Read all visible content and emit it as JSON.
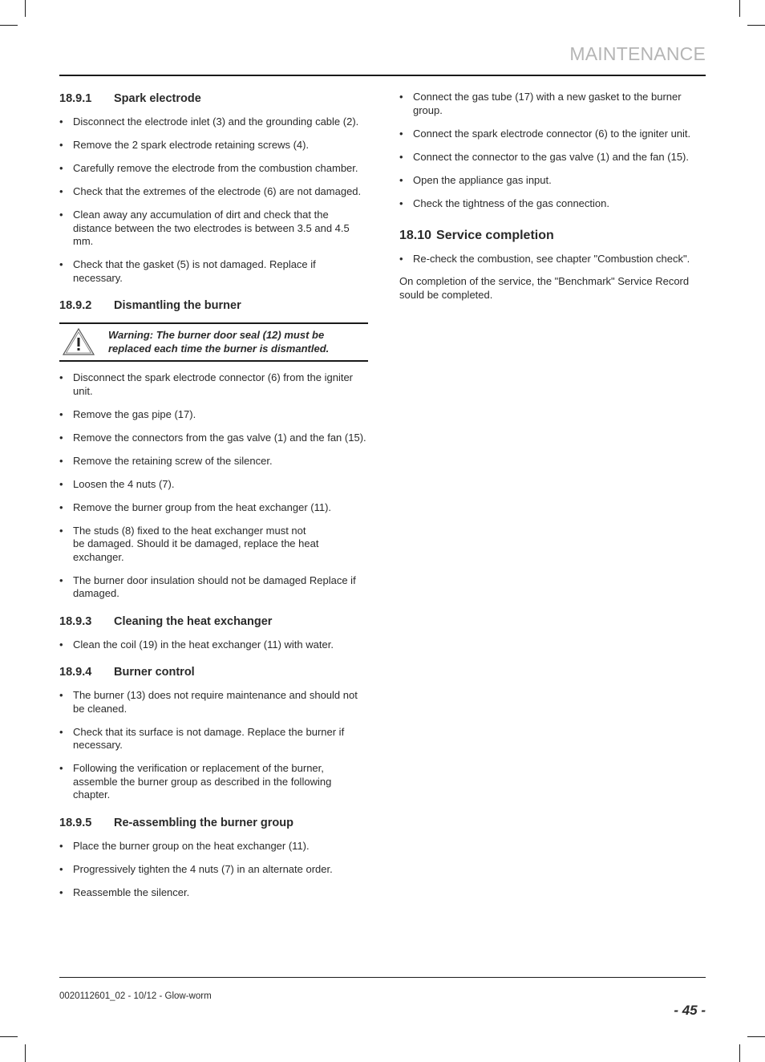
{
  "header": {
    "title": "MAINTENANCE"
  },
  "left_column": {
    "sections": [
      {
        "number": "18.9.1",
        "title": "Spark electrode",
        "items": [
          "Disconnect the electrode inlet (3) and the grounding cable (2).",
          "Remove the 2 spark electrode retaining screws (4).",
          "Carefully remove the electrode from the combustion chamber.",
          "Check that the extremes of the electrode (6) are not damaged.",
          "Clean away any accumulation of dirt and check that the distance between the two electrodes is between 3.5 and 4.5 mm.",
          "Check that the gasket (5) is not damaged. Replace if necessary."
        ]
      },
      {
        "number": "18.9.2",
        "title": "Dismantling the burner",
        "warning": "Warning: The burner door seal (12) must be replaced each time the burner is dismantled.",
        "items": [
          "Disconnect the spark electrode connector (6) from the igniter unit.",
          "Remove the gas pipe (17).",
          "Remove the connectors from the gas valve (1) and the fan (15).",
          "Remove the retaining screw of the silencer.",
          "Loosen the 4 nuts (7).",
          "Remove the burner group from the heat exchanger (11).",
          "The studs (8) fixed to the heat exchanger must not be damaged. Should it be damaged, replace the heat exchanger.",
          "The burner door insulation should not be damaged Replace if damaged."
        ]
      },
      {
        "number": "18.9.3",
        "title": "Cleaning the heat exchanger",
        "items": [
          "Clean the coil (19) in the heat exchanger (11) with water."
        ]
      },
      {
        "number": "18.9.4",
        "title": "Burner control",
        "items": [
          "The burner (13) does not require maintenance and should not be cleaned.",
          "Check that its surface is not damage. Replace the burner if necessary.",
          "Following the verification or replacement of the burner, assemble the burner group as described in the following chapter."
        ]
      },
      {
        "number": "18.9.5",
        "title": "Re-assembling the burner group",
        "items": [
          "Place the burner group on the heat exchanger (11).",
          "Progressively tighten the 4 nuts (7) in an alternate order.",
          "Reassemble the silencer."
        ]
      }
    ]
  },
  "right_column": {
    "continued_items": [
      "Connect the gas tube (17) with a new gasket to the burner group.",
      "Connect the spark electrode connector (6) to the igniter unit.",
      "Connect the connector to the gas valve (1) and the fan (15).",
      "Open the appliance gas input.",
      "Check the tightness of the gas connection."
    ],
    "section": {
      "number": "18.10",
      "title": "Service completion",
      "items": [
        "Re-check the combustion, see chapter \"Combustion check\"."
      ],
      "paragraph": "On completion of the service, the \"Benchmark\" Service Record sould be completed."
    }
  },
  "footer": {
    "doc_ref": "0020112601_02 - 10/12 - Glow-worm",
    "page_number": "- 45 -"
  },
  "bullet_char": "•"
}
